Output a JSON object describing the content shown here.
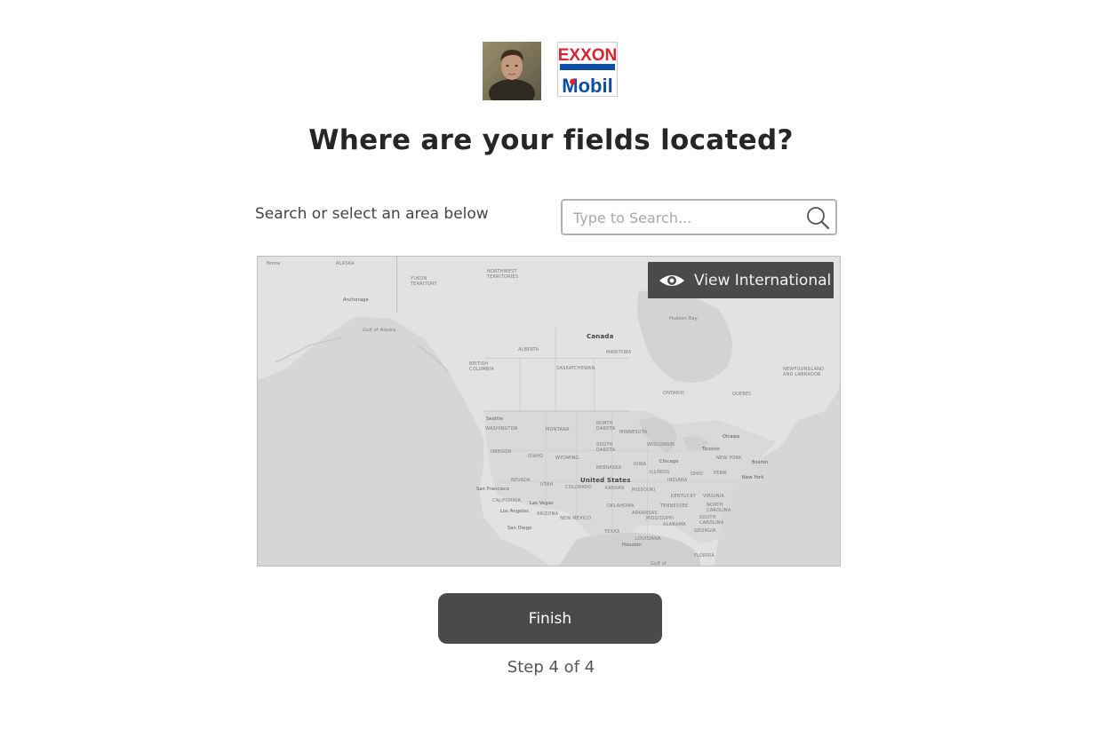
{
  "header": {
    "brand_line1": "EXXON",
    "brand_line2": "Mobil"
  },
  "page": {
    "title": "Where are your fields located?",
    "search_label": "Search or select an area below",
    "search_placeholder": "Type to Search...",
    "view_international_label": "View International",
    "finish_label": "Finish",
    "step_text": "Step 4 of 4"
  },
  "map": {
    "labels": [
      {
        "text": "Nome",
        "kind": "city"
      },
      {
        "text": "ALASKA",
        "kind": "region"
      },
      {
        "text": "Anchorage",
        "kind": "city"
      },
      {
        "text": "Gulf of Alaska",
        "kind": "water"
      },
      {
        "text": "YUKON TERRITORY",
        "kind": "region"
      },
      {
        "text": "NORTHWEST TERRITORIES",
        "kind": "region"
      },
      {
        "text": "Hudson Bay",
        "kind": "water"
      },
      {
        "text": "Canada",
        "kind": "country"
      },
      {
        "text": "BRITISH COLUMBIA",
        "kind": "region"
      },
      {
        "text": "ALBERTA",
        "kind": "region"
      },
      {
        "text": "SASKATCHEWAN",
        "kind": "region"
      },
      {
        "text": "MANITOBA",
        "kind": "region"
      },
      {
        "text": "ONTARIO",
        "kind": "region"
      },
      {
        "text": "QUEBEC",
        "kind": "region"
      },
      {
        "text": "NEWFOUNDLAND AND LABRADOR",
        "kind": "region"
      },
      {
        "text": "Seattle",
        "kind": "city"
      },
      {
        "text": "WASHINGTON",
        "kind": "region"
      },
      {
        "text": "MONTANA",
        "kind": "region"
      },
      {
        "text": "NORTH DAKOTA",
        "kind": "region"
      },
      {
        "text": "MINNESOTA",
        "kind": "region"
      },
      {
        "text": "OREGON",
        "kind": "region"
      },
      {
        "text": "IDAHO",
        "kind": "region"
      },
      {
        "text": "WYOMING",
        "kind": "region"
      },
      {
        "text": "SOUTH DAKOTA",
        "kind": "region"
      },
      {
        "text": "WISCONSIN",
        "kind": "region"
      },
      {
        "text": "Ottawa",
        "kind": "city"
      },
      {
        "text": "Toronto",
        "kind": "city"
      },
      {
        "text": "NEW YORK",
        "kind": "region"
      },
      {
        "text": "Boston",
        "kind": "city"
      },
      {
        "text": "NEBRASKA",
        "kind": "region"
      },
      {
        "text": "IOWA",
        "kind": "region"
      },
      {
        "text": "Chicago",
        "kind": "city"
      },
      {
        "text": "NEVADA",
        "kind": "region"
      },
      {
        "text": "UTAH",
        "kind": "region"
      },
      {
        "text": "United States",
        "kind": "country"
      },
      {
        "text": "COLORADO",
        "kind": "region"
      },
      {
        "text": "KANSAS",
        "kind": "region"
      },
      {
        "text": "MISSOURI",
        "kind": "region"
      },
      {
        "text": "ILLINOIS",
        "kind": "region"
      },
      {
        "text": "INDIANA",
        "kind": "region"
      },
      {
        "text": "OHIO",
        "kind": "region"
      },
      {
        "text": "PENN",
        "kind": "region"
      },
      {
        "text": "New York",
        "kind": "city"
      },
      {
        "text": "San Francisco",
        "kind": "city"
      },
      {
        "text": "CALIFORNIA",
        "kind": "region"
      },
      {
        "text": "Las Vegas",
        "kind": "city"
      },
      {
        "text": "KENTUCKY",
        "kind": "region"
      },
      {
        "text": "VIRGINIA",
        "kind": "region"
      },
      {
        "text": "OKLAHOMA",
        "kind": "region"
      },
      {
        "text": "TENNESSEE",
        "kind": "region"
      },
      {
        "text": "NORTH CAROLINA",
        "kind": "region"
      },
      {
        "text": "Los Angeles",
        "kind": "city"
      },
      {
        "text": "ARIZONA",
        "kind": "region"
      },
      {
        "text": "NEW MEXICO",
        "kind": "region"
      },
      {
        "text": "ARKANSAS",
        "kind": "region"
      },
      {
        "text": "MISSISSIPPI",
        "kind": "region"
      },
      {
        "text": "ALABAMA",
        "kind": "region"
      },
      {
        "text": "SOUTH CAROLINA",
        "kind": "region"
      },
      {
        "text": "GEORGIA",
        "kind": "region"
      },
      {
        "text": "San Diego",
        "kind": "city"
      },
      {
        "text": "TEXAS",
        "kind": "region"
      },
      {
        "text": "LOUISIANA",
        "kind": "region"
      },
      {
        "text": "Houston",
        "kind": "city"
      },
      {
        "text": "FLORIDA",
        "kind": "region"
      },
      {
        "text": "Gulf of",
        "kind": "water"
      }
    ]
  },
  "colors": {
    "button_bg": "#4a4a4a",
    "title": "#262626",
    "exxon_red": "#d9232e",
    "mobil_blue": "#0b4ea2"
  },
  "icons": {
    "avatar": "user-avatar",
    "search": "search-icon",
    "view": "eye-icon"
  }
}
